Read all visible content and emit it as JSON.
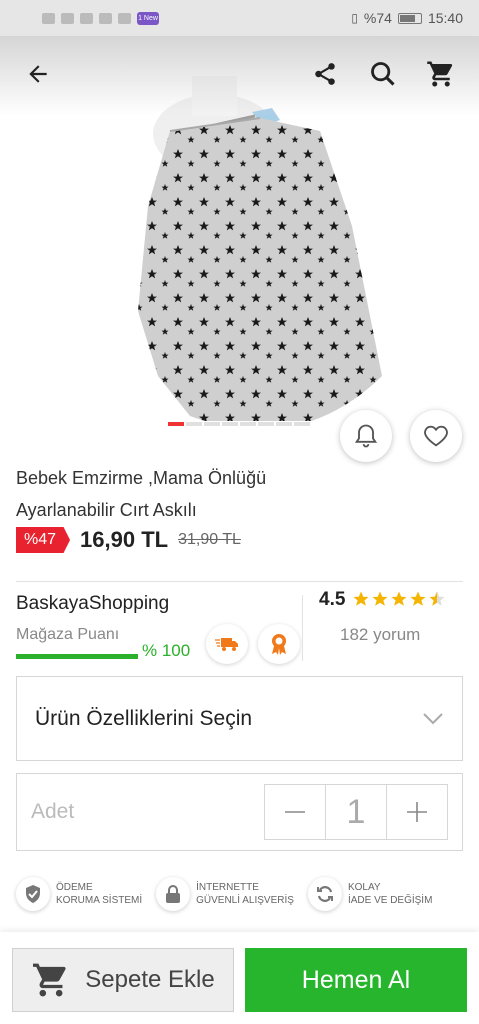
{
  "status_bar": {
    "battery": "%74",
    "time": "15:40",
    "new_badge": "1 New"
  },
  "toolbar": {
    "back_icon": "arrow-left-icon",
    "share_icon": "share-icon",
    "search_icon": "search-icon",
    "cart_icon": "cart-icon"
  },
  "gallery": {
    "image_count": 8,
    "active_index": 0
  },
  "product": {
    "title": "Bebek  Emzirme ,Mama Önlüğü Ayarlanabilir Cırt Askılı",
    "discount": "%47",
    "price": "16,90 TL",
    "old_price": "31,90 TL"
  },
  "seller": {
    "name": "BaskayaShopping",
    "score_label": "Mağaza Puanı",
    "score_value": "% 100",
    "score_fraction": 1.0,
    "rating": "4.5",
    "rating_value": 4.5,
    "reviews": "182 yorum"
  },
  "options": {
    "select_label": "Ürün Özelliklerini Seçin",
    "qty_label": "Adet",
    "qty_value": "1"
  },
  "trust": [
    {
      "line1": "ÖDEME",
      "line2": "KORUMA SİSTEMİ"
    },
    {
      "line1": "İNTERNETTE",
      "line2": "GÜVENLİ ALIŞVERİŞ"
    },
    {
      "line1": "KOLAY",
      "line2": "İADE VE DEĞİŞİM"
    }
  ],
  "actions": {
    "add_to_cart": "Sepete Ekle",
    "buy_now": "Hemen Al"
  },
  "colors": {
    "discount_red": "#e8222e",
    "buy_green": "#28b52e",
    "star_yellow": "#f4b400"
  }
}
